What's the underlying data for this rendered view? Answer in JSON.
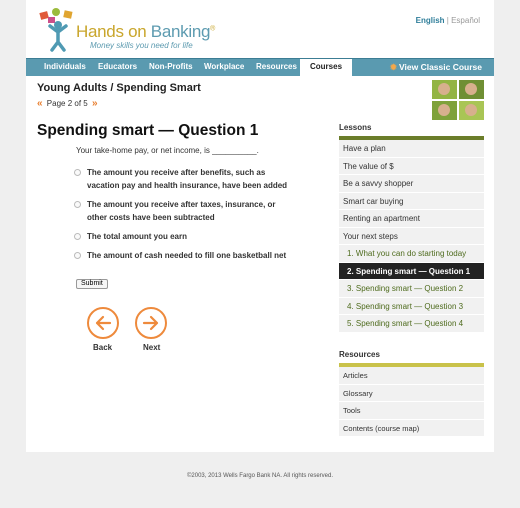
{
  "brand": {
    "name_part1": "Hands on ",
    "name_part2": "Banking",
    "reg": "®",
    "tagline": "Money skills you need for life"
  },
  "language": {
    "english": "English",
    "separator": " | ",
    "spanish": "Español"
  },
  "nav": {
    "tabs": [
      {
        "label": "Individuals",
        "active": false
      },
      {
        "label": "Educators",
        "active": false
      },
      {
        "label": "Non-Profits",
        "active": false
      },
      {
        "label": "Workplace",
        "active": false
      },
      {
        "label": "Resources",
        "active": false
      },
      {
        "label": "Courses",
        "active": true
      }
    ],
    "classic_label": "View Classic Course",
    "colors": {
      "bar": "#5a9ab0",
      "accent": "#ee8a3c"
    }
  },
  "course": {
    "title": "Young Adults / Spending Smart",
    "prev_glyph": "«",
    "page_label": "Page 2 of 5",
    "next_glyph": "»"
  },
  "question": {
    "title": "Spending smart — Question 1",
    "text": "Your take-home pay, or net income, is __________.",
    "options": [
      "The amount you receive after benefits, such as vacation pay and health insurance, have been added",
      "The amount you receive after taxes, insurance, or other costs have been subtracted",
      "The total amount you earn",
      "The amount of cash needed to fill one basketball net"
    ],
    "submit_label": "Submit",
    "back_label": "Back",
    "next_label": "Next"
  },
  "lessons": {
    "heading": "Lessons",
    "bar_color": "#6b7d2a",
    "items": [
      {
        "label": "Have a plan",
        "sub": false,
        "current": false
      },
      {
        "label": "The value of $",
        "sub": false,
        "current": false
      },
      {
        "label": "Be a savvy shopper",
        "sub": false,
        "current": false
      },
      {
        "label": "Smart car buying",
        "sub": false,
        "current": false
      },
      {
        "label": "Renting an apartment",
        "sub": false,
        "current": false
      },
      {
        "label": "Your next steps",
        "sub": false,
        "current": false
      },
      {
        "label": "1. What you can do starting today",
        "sub": true,
        "current": false
      },
      {
        "label": "2. Spending smart — Question 1",
        "sub": true,
        "current": true
      },
      {
        "label": "3. Spending smart — Question 2",
        "sub": true,
        "current": false
      },
      {
        "label": "4. Spending smart — Question 3",
        "sub": true,
        "current": false
      },
      {
        "label": "5. Spending smart — Question 4",
        "sub": true,
        "current": false
      }
    ]
  },
  "resources": {
    "heading": "Resources",
    "bar_color": "#c9c24a",
    "items": [
      "Articles",
      "Glossary",
      "Tools",
      "Contents (course map)"
    ]
  },
  "footer": {
    "copyright": "©2003, 2013 Wells Fargo Bank NA. All rights reserved."
  }
}
